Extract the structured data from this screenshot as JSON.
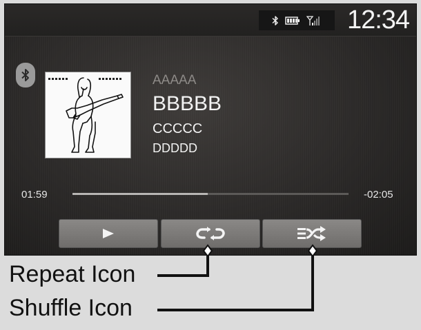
{
  "status_bar": {
    "icons": [
      "bluetooth-icon",
      "battery-icon",
      "signal-icon"
    ],
    "clock": "12:34"
  },
  "source": {
    "icon": "bluetooth-icon"
  },
  "track": {
    "artist": "AAAAA",
    "title": "BBBBB",
    "album": "CCCCC",
    "extra": "DDDDD"
  },
  "progress": {
    "elapsed": "01:59",
    "remaining": "-02:05",
    "fraction": 0.49
  },
  "controls": [
    {
      "name": "play-button",
      "icon": "play-icon"
    },
    {
      "name": "repeat-button",
      "icon": "repeat-icon"
    },
    {
      "name": "shuffle-button",
      "icon": "shuffle-icon"
    }
  ],
  "callouts": {
    "repeat": "Repeat Icon",
    "shuffle": "Shuffle Icon"
  },
  "colors": {
    "screen_bg": "#2b2928",
    "button_bg": "#7c7a78",
    "text_primary": "#f2f2f2",
    "text_muted": "#8e8b88"
  }
}
